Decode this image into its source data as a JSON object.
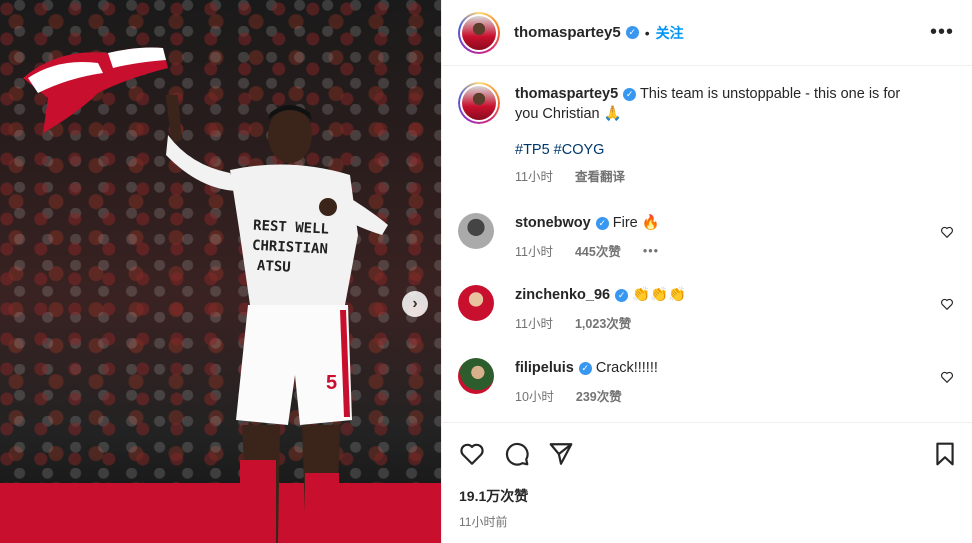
{
  "post": {
    "username": "thomaspartey5",
    "follow_label": "关注",
    "caption": "This team is unstoppable - this one is for you Christian",
    "caption_emoji": "🙏",
    "hashtags": "#TP5 #COYG",
    "caption_time": "11小时",
    "translate_label": "查看翻译",
    "shirt_text": [
      "REST WELL",
      "CHRISTIAN",
      "ATSU"
    ],
    "shirt_number": "5"
  },
  "comments": [
    {
      "username": "stonebwoy",
      "text": "Fire",
      "emoji": "🔥",
      "time": "11小时",
      "likes": "445次赞",
      "has_more": true
    },
    {
      "username": "zinchenko_96",
      "text": "",
      "emoji": "👏👏👏",
      "time": "11小时",
      "likes": "1,023次赞",
      "has_more": false
    },
    {
      "username": "filipeluis",
      "text": "Crack!!!!!!",
      "emoji": "",
      "time": "10小时",
      "likes": "239次赞",
      "has_more": false
    }
  ],
  "footer": {
    "like_count": "19.1万次赞",
    "posted_ago": "11小时前"
  },
  "icons": {
    "more": "more-options-icon",
    "verified": "verified-badge-icon",
    "like": "heart-icon",
    "comment": "comment-icon",
    "share": "share-icon",
    "save": "bookmark-icon",
    "next": "chevron-right-icon"
  },
  "colors": {
    "link": "#0095f6",
    "hashtag": "#00376b",
    "verified": "#3897f0",
    "meta": "#737373"
  }
}
